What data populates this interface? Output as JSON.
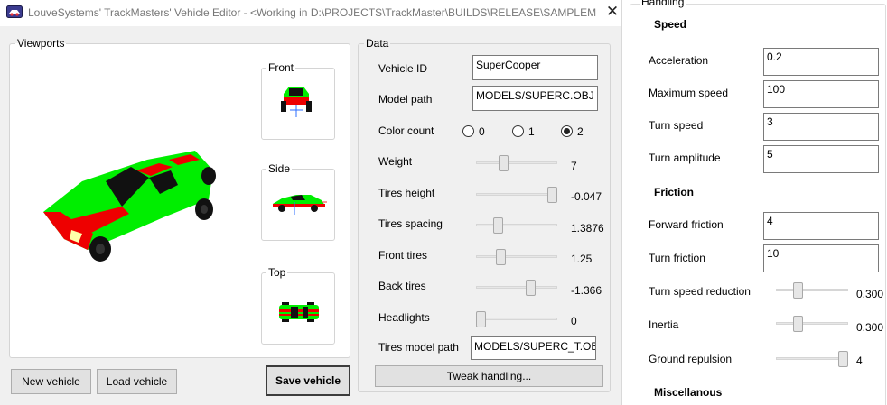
{
  "window": {
    "title": "LouveSystems' TrackMasters' Vehicle Editor - <Working in D:\\PROJECTS\\TrackMaster\\BUILDS\\RELEASE\\SAMPLEMP\\Ad...",
    "close_glyph": "✕"
  },
  "viewports": {
    "title": "Viewports",
    "front_label": "Front",
    "side_label": "Side",
    "top_label": "Top"
  },
  "data": {
    "title": "Data",
    "vehicle_id": {
      "label": "Vehicle ID",
      "value": "SuperCooper"
    },
    "model_path": {
      "label": "Model path",
      "value": "MODELS/SUPERC.OBJ"
    },
    "color_count": {
      "label": "Color count",
      "options": [
        "0",
        "1",
        "2"
      ],
      "selected": "2"
    },
    "sliders": [
      {
        "label": "Weight",
        "value": "7",
        "level": 0.33
      },
      {
        "label": "Tires height",
        "value": "-0.047",
        "level": 0.93
      },
      {
        "label": "Tires spacing",
        "value": "1.3876",
        "level": 0.27
      },
      {
        "label": "Front tires",
        "value": "1.25",
        "level": 0.3
      },
      {
        "label": "Back tires",
        "value": "-1.366",
        "level": 0.67
      },
      {
        "label": "Headlights",
        "value": "0",
        "level": 0.05
      }
    ],
    "tires_model_path": {
      "label": "Tires model path",
      "value": "MODELS/SUPERC_T.OBJ"
    },
    "tweak_handling_label": "Tweak handling..."
  },
  "buttons": {
    "new_vehicle": "New vehicle",
    "load_vehicle": "Load vehicle",
    "save_vehicle": "Save vehicle"
  },
  "handling": {
    "title": "Handling",
    "speed_section": "Speed",
    "acceleration": {
      "label": "Acceleration",
      "value": "0.2"
    },
    "maximum_speed": {
      "label": "Maximum speed",
      "value": "100"
    },
    "turn_speed": {
      "label": "Turn speed",
      "value": "3"
    },
    "turn_amplitude": {
      "label": "Turn amplitude",
      "value": "5"
    },
    "friction_section": "Friction",
    "forward_friction": {
      "label": "Forward friction",
      "value": "4"
    },
    "turn_friction": {
      "label": "Turn friction",
      "value": "10"
    },
    "turn_speed_reduction": {
      "label": "Turn speed reduction",
      "value": "0.300",
      "level": 0.3
    },
    "inertia": {
      "label": "Inertia",
      "value": "0.300",
      "level": 0.3
    },
    "ground_repulsion": {
      "label": "Ground repulsion",
      "value": "4",
      "level": 0.93
    },
    "misc_section": "Miscellanous"
  },
  "colors": {
    "car_body": "#00ee00",
    "car_stripe": "#ee0000",
    "car_dark": "#111111",
    "accent_radio": "#222222"
  },
  "icons": [
    "app-icon",
    "close-icon"
  ]
}
